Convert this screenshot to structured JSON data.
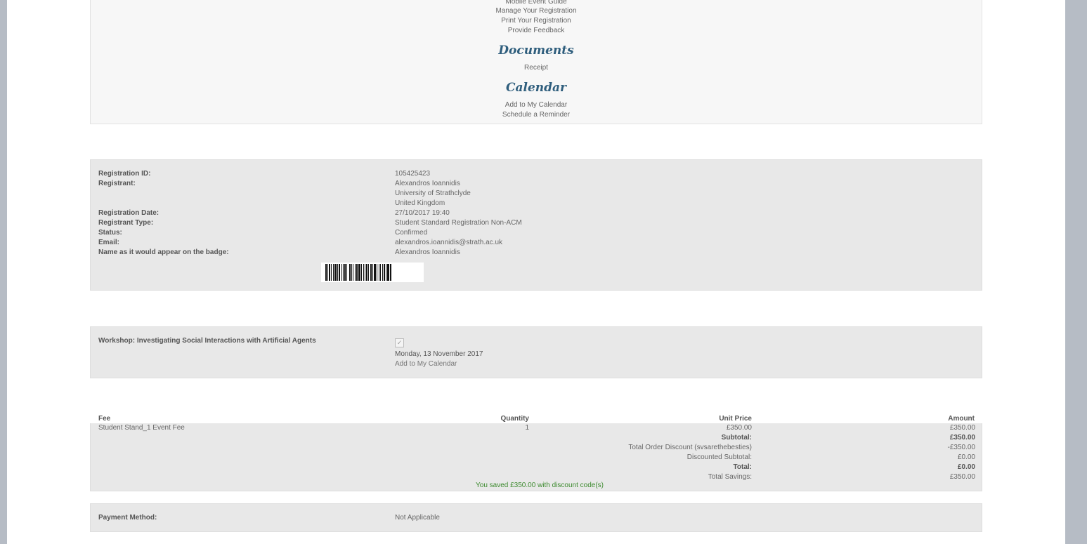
{
  "links": {
    "mobile_guide": "Mobile Event Guide",
    "manage": "Manage Your Registration",
    "print": "Print Your Registration",
    "feedback": "Provide Feedback",
    "documents_heading": "Documents",
    "receipt": "Receipt",
    "calendar_heading": "Calendar",
    "add_calendar": "Add to My Calendar",
    "reminder": "Schedule a Reminder"
  },
  "registration": {
    "id_label": "Registration ID:",
    "id_value": "105425423",
    "registrant_label": "Registrant:",
    "registrant_name": "Alexandros Ioannidis",
    "registrant_org": "University of Strathclyde",
    "registrant_country": "United Kingdom",
    "date_label": "Registration Date:",
    "date_value": "27/10/2017 19:40",
    "type_label": "Registrant Type:",
    "type_value": "Student Standard Registration Non-ACM",
    "status_label": "Status:",
    "status_value": "Confirmed",
    "email_label": "Email:",
    "email_value": "alexandros.ioannidis@strath.ac.uk",
    "badge_label": "Name as it would appear on the badge:",
    "badge_value": "Alexandros Ioannidis"
  },
  "workshop": {
    "label": "Workshop: Investigating Social Interactions with Artificial Agents",
    "checked": true,
    "date": "Monday, 13 November 2017",
    "add_calendar": "Add to My Calendar"
  },
  "fees": {
    "headers": {
      "fee": "Fee",
      "quantity": "Quantity",
      "unit_price": "Unit Price",
      "amount": "Amount"
    },
    "item": {
      "name": "Student Stand_1 Event Fee",
      "quantity": "1",
      "unit_price": "£350.00",
      "amount": "£350.00"
    },
    "subtotal_label": "Subtotal:",
    "subtotal_value": "£350.00",
    "discount_label": "Total Order Discount (svsarethebesties)",
    "discount_value": "-£350.00",
    "discounted_subtotal_label": "Discounted Subtotal:",
    "discounted_subtotal_value": "£0.00",
    "total_label": "Total:",
    "total_value": "£0.00",
    "savings_label": "Total Savings:",
    "savings_value": "£350.00",
    "saved_message": "You saved £350.00 with discount code(s)"
  },
  "payment": {
    "label": "Payment Method:",
    "value": "Not Applicable"
  }
}
